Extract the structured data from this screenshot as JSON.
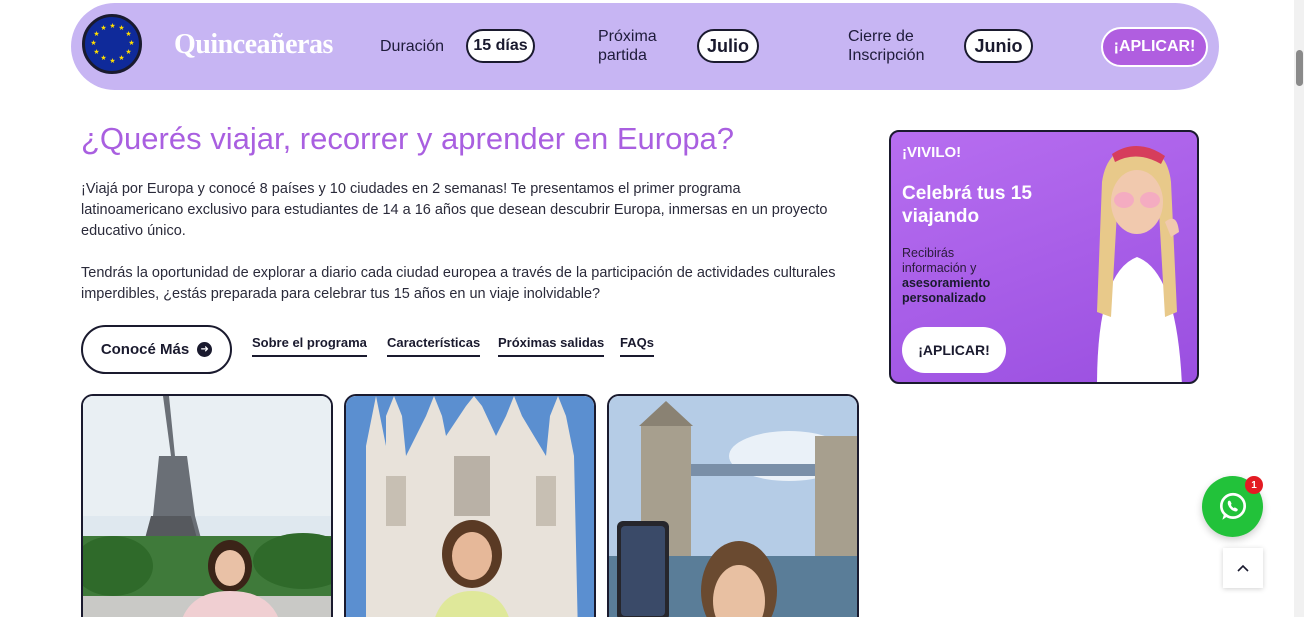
{
  "header": {
    "brand": "Quinceañeras",
    "flag_icon": "eu-flag-icon",
    "duration_label": "Duración",
    "duration_value": "15 días",
    "next_departure_label_1": "Próxima",
    "next_departure_label_2": "partida",
    "next_departure_value": "Julio",
    "closing_label_1": "Cierre de",
    "closing_label_2": "Inscripción",
    "closing_value": "Junio",
    "apply_label": "¡APLICAR!"
  },
  "main": {
    "title": "¿Querés viajar, recorrer y aprender en Europa?",
    "paragraph_1": "¡Viajá por Europa y conocé 8 países y 10 ciudades en 2 semanas! Te presentamos el primer programa latinoamericano exclusivo para estudiantes de 14 a 16 años que desean descubrir Europa, inmersas en un proyecto educativo único.",
    "paragraph_2": "Tendrás la oportunidad de explorar a diario cada ciudad europea a través de la participación de actividades culturales imperdibles, ¿estás preparada para celebrar tus 15 años en un viaje inolvidable?",
    "more_button": "Conocé Más",
    "links": [
      "Sobre el programa",
      "Características",
      "Próximas salidas",
      "FAQs"
    ]
  },
  "cards": [
    {
      "name": "paris-photo",
      "alt": "Eiffel tower"
    },
    {
      "name": "milan-photo",
      "alt": "Milan cathedral"
    },
    {
      "name": "london-photo",
      "alt": "Tower bridge"
    }
  ],
  "promo": {
    "eyebrow": "¡VIVILO!",
    "title": "Celebrá tus 15 viajando",
    "text_plain": "Recibirás información y",
    "text_bold": "asesoramiento personalizado",
    "button": "¡APLICAR!"
  },
  "widgets": {
    "whatsapp_badge": "1"
  },
  "colors": {
    "banner": "#c7b5f3",
    "accent_purple": "#a95fe0",
    "apply_button": "#b05ee0",
    "whatsapp": "#22c23a"
  }
}
